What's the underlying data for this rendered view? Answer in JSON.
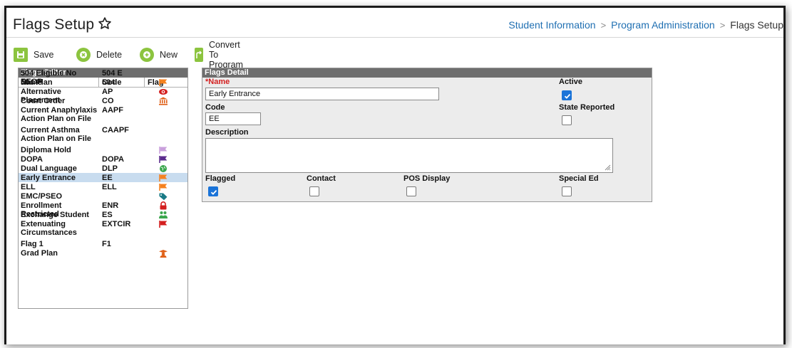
{
  "header": {
    "title": "Flags Setup",
    "breadcrumb": [
      "Student Information",
      "Program Administration",
      "Flags Setup"
    ]
  },
  "toolbar": {
    "save": "Save",
    "delete": "Delete",
    "new": "New",
    "convert": "Convert To Program"
  },
  "editor": {
    "title": "Flags Editor",
    "columns": [
      "Name",
      "Code",
      "Flag"
    ],
    "rows": [
      {
        "name": "504 Eligible No EEOP",
        "code": "504 E",
        "icon": "none"
      },
      {
        "name": "504 Plan",
        "code": "504",
        "icon": "flag-icon",
        "color": "#f58220"
      },
      {
        "name": "Alternative Placement",
        "code": "AP",
        "icon": "eye-icon",
        "color": "#d41f1f"
      },
      {
        "name": "Court Order",
        "code": "CO",
        "icon": "courthouse-icon",
        "color": "#e0621a"
      },
      {
        "name": "Current Anaphylaxis Action Plan on File",
        "code": "AAPF",
        "icon": "none"
      },
      {
        "name": "Current Asthma Action Plan on File",
        "code": "CAAPF",
        "icon": "none"
      },
      {
        "name": "Diploma Hold",
        "code": "",
        "icon": "flag-icon",
        "color": "#c9a0dc"
      },
      {
        "name": "DOPA",
        "code": "DOPA",
        "icon": "flag-icon",
        "color": "#5b2c8e"
      },
      {
        "name": "Dual Language",
        "code": "DLP",
        "icon": "globe-icon",
        "color": "#3aa64c"
      },
      {
        "name": "Early Entrance",
        "code": "EE",
        "icon": "flag-icon",
        "color": "#f58220",
        "selected": true
      },
      {
        "name": "ELL",
        "code": "ELL",
        "icon": "flag-icon",
        "color": "#f58220"
      },
      {
        "name": "EMC/PSEO",
        "code": "",
        "icon": "tag-icon",
        "color": "#1a7a86"
      },
      {
        "name": "Enrollment Restricted",
        "code": "ENR",
        "icon": "lock-icon",
        "color": "#d41f1f"
      },
      {
        "name": "Exchange Student",
        "code": "ES",
        "icon": "people-icon",
        "color": "#3aa64c"
      },
      {
        "name": "Extenuating Circumstances",
        "code": "EXTCIR",
        "icon": "flag-icon",
        "color": "#d41f1f"
      },
      {
        "name": "Flag 1",
        "code": "F1",
        "icon": "none"
      },
      {
        "name": "Grad Plan",
        "code": "",
        "icon": "graduate-icon",
        "color": "#e0621a"
      }
    ]
  },
  "detail": {
    "title": "Flags Detail",
    "name_label": "*Name",
    "name_value": "Early Entrance",
    "code_label": "Code",
    "code_value": "EE",
    "description_label": "Description",
    "active_label": "Active",
    "active": true,
    "state_label": "State Reported",
    "state": false,
    "flagged_label": "Flagged",
    "flagged": true,
    "contact_label": "Contact",
    "contact": false,
    "pos_label": "POS Display",
    "pos": false,
    "sped_label": "Special Ed",
    "sped": false
  },
  "colors": {
    "accent": "#8cc43f",
    "link": "#1f6fb2",
    "panel_header": "#6e6e6e",
    "selected_row": "#c8dcef",
    "checkbox": "#1a73d8",
    "required": "#d32020"
  }
}
